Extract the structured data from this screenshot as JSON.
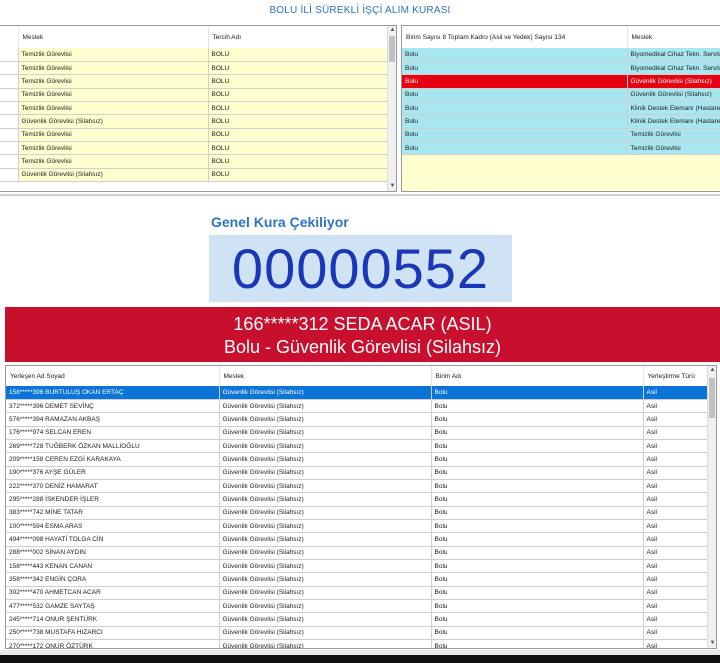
{
  "window": {
    "title": "BOLU İLİ SÜREKLİ İŞÇİ ALIM KURASI"
  },
  "left_grid": {
    "columns": [
      "Meslek",
      "Tercih Adı"
    ],
    "rows": [
      [
        "Temizlik Görevlisi",
        "BOLU"
      ],
      [
        "Temizlik Görevlisi",
        "BOLU"
      ],
      [
        "Temizlik Görevlisi",
        "BOLU"
      ],
      [
        "Temizlik Görevlisi",
        "BOLU"
      ],
      [
        "Temizlik Görevlisi",
        "BOLU"
      ],
      [
        "Güvenlik Görevlisi (Silahsız)",
        "BOLU"
      ],
      [
        "Temizlik Görevlisi",
        "BOLU"
      ],
      [
        "Temizlik Görevlisi",
        "BOLU"
      ],
      [
        "Temizlik Görevlisi",
        "BOLU"
      ],
      [
        "Güvenlik Görevlisi (Silahsız)",
        "BOLU"
      ]
    ]
  },
  "right_grid": {
    "columns": [
      "Birim Sayısı 8 Toplam Kadro (Asil ve Yedek) Sayısı 134",
      "Meslek"
    ],
    "rows": [
      [
        "Bolu",
        "Biyomedikal Cihaz Tekn. Servis"
      ],
      [
        "Bolu",
        "Biyomedikal Cihaz Tekn. Servis"
      ],
      [
        "Bolu",
        "Güvenlik Görevlisi (Silahsız)"
      ],
      [
        "Bolu",
        "Güvenlik Görevlisi (Silahsız)"
      ],
      [
        "Bolu",
        "Klinik Destek Elemanı (Hastane"
      ],
      [
        "Bolu",
        "Klinik Destek Elemanı (Hastane"
      ],
      [
        "Bolu",
        "Temizlik Görevlisi"
      ],
      [
        "Bolu",
        "Temizlik Görevlisi"
      ]
    ],
    "highlighted_row": 2
  },
  "draw": {
    "label": "Genel Kura Çekiliyor",
    "number": "00000552",
    "result_line1": "166*****312 SEDA ACAR (ASIL)",
    "result_line2": "Bolu - Güvenlik Görevlisi (Silahsız)"
  },
  "bottom_grid": {
    "columns": [
      "Yerleşen Ad Soyad",
      "Meslek",
      "Birim Adı",
      "Yerleştirme Türü"
    ],
    "rows": [
      [
        "158*****396 BURTULUŞ OKAN ERTAÇ",
        "Güvenlik Görevlisi (Silahsız)",
        "Bolu",
        "Asil"
      ],
      [
        "372*****396 DEMET SEVİNÇ",
        "Güvenlik Görevlisi (Silahsız)",
        "Bolu",
        "Asil"
      ],
      [
        "576*****394 RAMAZAN AKBAŞ",
        "Güvenlik Görevlisi (Silahsız)",
        "Bolu",
        "Asil"
      ],
      [
        "176*****974 SELCAN EREN",
        "Güvenlik Görevlisi (Silahsız)",
        "Bolu",
        "Asil"
      ],
      [
        "269*****728 TUĞBERK ÖZKAN MALLIOĞLU",
        "Güvenlik Görevlisi (Silahsız)",
        "Bolu",
        "Asil"
      ],
      [
        "209*****158 CEREN EZGİ KARAKAYA",
        "Güvenlik Görevlisi (Silahsız)",
        "Bolu",
        "Asil"
      ],
      [
        "190*****376 AYŞE GÜLER",
        "Güvenlik Görevlisi (Silahsız)",
        "Bolu",
        "Asil"
      ],
      [
        "222*****370 DENİZ HAMARAT",
        "Güvenlik Görevlisi (Silahsız)",
        "Bolu",
        "Asil"
      ],
      [
        "295*****288 İSKENDER İŞLER",
        "Güvenlik Görevlisi (Silahsız)",
        "Bolu",
        "Asil"
      ],
      [
        "383*****742 MİNE TATAR",
        "Güvenlik Görevlisi (Silahsız)",
        "Bolu",
        "Asil"
      ],
      [
        "100*****594 ESMA ARAS",
        "Güvenlik Görevlisi (Silahsız)",
        "Bolu",
        "Asil"
      ],
      [
        "494*****098 HAYATİ TOLGA CİN",
        "Güvenlik Görevlisi (Silahsız)",
        "Bolu",
        "Asil"
      ],
      [
        "288*****002 SİNAN AYDIN",
        "Güvenlik Görevlisi (Silahsız)",
        "Bolu",
        "Asil"
      ],
      [
        "158*****443 KENAN CANAN",
        "Güvenlik Görevlisi (Silahsız)",
        "Bolu",
        "Asil"
      ],
      [
        "358*****342 ENGİN ÇORA",
        "Güvenlik Görevlisi (Silahsız)",
        "Bolu",
        "Asil"
      ],
      [
        "302*****470 AHMETCAN ACAR",
        "Güvenlik Görevlisi (Silahsız)",
        "Bolu",
        "Asil"
      ],
      [
        "477*****532 GAMZE SAYTAŞ",
        "Güvenlik Görevlisi (Silahsız)",
        "Bolu",
        "Asil"
      ],
      [
        "245*****714 ONUR ŞENTÜRK",
        "Güvenlik Görevlisi (Silahsız)",
        "Bolu",
        "Asil"
      ],
      [
        "250*****738 MUSTAFA HIZARCI",
        "Güvenlik Görevlisi (Silahsız)",
        "Bolu",
        "Asil"
      ],
      [
        "270*****172 ONUR ÖZTÜRK",
        "Güvenlik Görevlisi (Silahsız)",
        "Bolu",
        "Asil"
      ]
    ],
    "selected_row": 0
  },
  "colors": {
    "accent_blue": "#2e74c0",
    "number_blue": "#1a37b8",
    "number_bg": "#cfe3f5",
    "result_red": "#c8102e",
    "highlight_red": "#e60012",
    "selection_blue": "#0a74d9",
    "left_row_bg": "#ffffd0",
    "right_row_bg": "#a8e6f0"
  }
}
